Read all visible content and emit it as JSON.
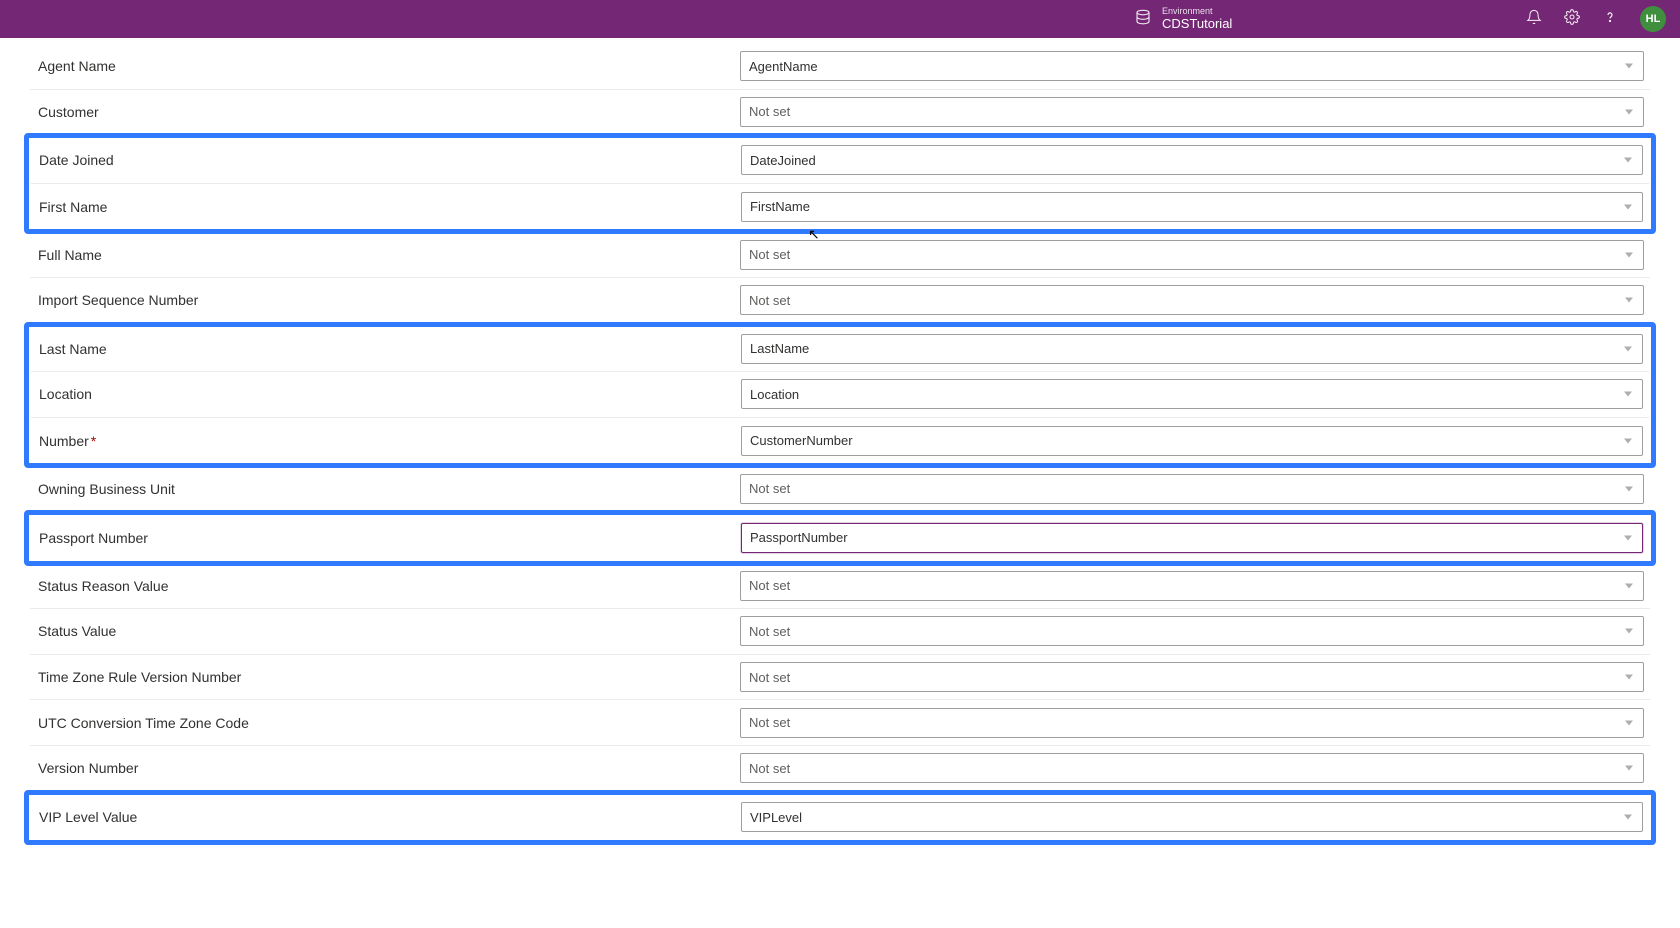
{
  "header": {
    "env_label": "Environment",
    "env_name": "CDSTutorial",
    "avatar_initials": "HL"
  },
  "rows": [
    {
      "label": "Agent Name",
      "value": "AgentName",
      "required": false,
      "highlightGroup": null,
      "active": false
    },
    {
      "label": "Customer",
      "value": "Not set",
      "required": false,
      "highlightGroup": null,
      "active": false
    },
    {
      "label": "Date Joined",
      "value": "DateJoined",
      "required": false,
      "highlightGroup": 1,
      "active": false
    },
    {
      "label": "First Name",
      "value": "FirstName",
      "required": false,
      "highlightGroup": 1,
      "active": false
    },
    {
      "label": "Full Name",
      "value": "Not set",
      "required": false,
      "highlightGroup": null,
      "active": false
    },
    {
      "label": "Import Sequence Number",
      "value": "Not set",
      "required": false,
      "highlightGroup": null,
      "active": false
    },
    {
      "label": "Last Name",
      "value": "LastName",
      "required": false,
      "highlightGroup": 2,
      "active": false
    },
    {
      "label": "Location",
      "value": "Location",
      "required": false,
      "highlightGroup": 2,
      "active": false
    },
    {
      "label": "Number",
      "value": "CustomerNumber",
      "required": true,
      "highlightGroup": 2,
      "active": false
    },
    {
      "label": "Owning Business Unit",
      "value": "Not set",
      "required": false,
      "highlightGroup": null,
      "active": false
    },
    {
      "label": "Passport Number",
      "value": "PassportNumber",
      "required": false,
      "highlightGroup": 3,
      "active": true
    },
    {
      "label": "Status Reason Value",
      "value": "Not set",
      "required": false,
      "highlightGroup": null,
      "active": false
    },
    {
      "label": "Status Value",
      "value": "Not set",
      "required": false,
      "highlightGroup": null,
      "active": false
    },
    {
      "label": "Time Zone Rule Version Number",
      "value": "Not set",
      "required": false,
      "highlightGroup": null,
      "active": false
    },
    {
      "label": "UTC Conversion Time Zone Code",
      "value": "Not set",
      "required": false,
      "highlightGroup": null,
      "active": false
    },
    {
      "label": "Version Number",
      "value": "Not set",
      "required": false,
      "highlightGroup": null,
      "active": false
    },
    {
      "label": "VIP Level Value",
      "value": "VIPLevel",
      "required": false,
      "highlightGroup": 4,
      "active": false
    }
  ]
}
